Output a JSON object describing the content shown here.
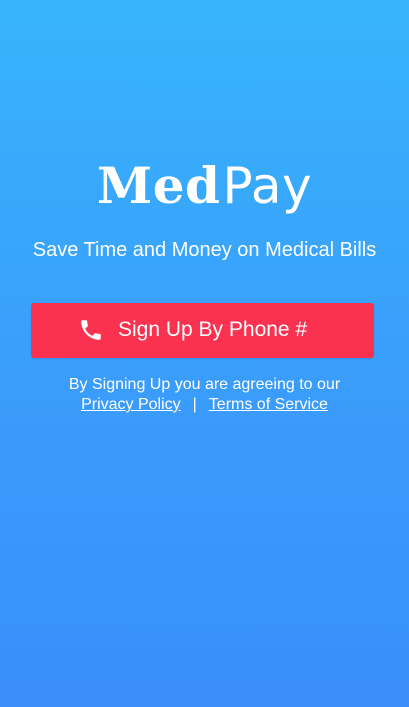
{
  "app": {
    "logo_bold": "Med",
    "logo_light": "Pay",
    "tagline": "Save Time and Money on Medical Bills"
  },
  "signup": {
    "button_label": "Sign Up By Phone #",
    "icon": "phone-icon"
  },
  "legal": {
    "notice": "By Signing Up you are agreeing to our",
    "privacy_link": "Privacy Policy",
    "separator": "|",
    "terms_link": "Terms of Service"
  },
  "colors": {
    "background_top": "#37b4fb",
    "background_bottom": "#3a8efb",
    "button": "#fb3150",
    "text": "#ffffff"
  }
}
